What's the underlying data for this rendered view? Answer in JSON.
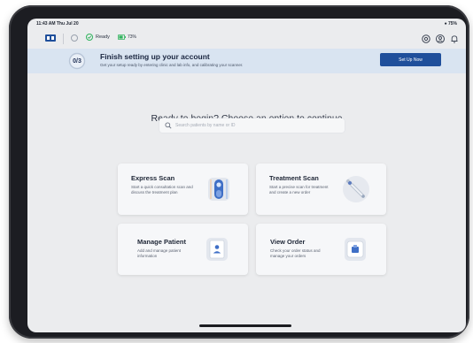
{
  "status_bar": {
    "time": "11:43 AM Thu Jul 20",
    "battery": "75%"
  },
  "topbar": {
    "ready_label": "Ready",
    "battery_label": "73%"
  },
  "banner": {
    "progress": "0/3",
    "progress_fraction": 0,
    "title": "Finish setting up your account",
    "subtitle": "Get your setup ready by entering clinic and lab info, and calibrating your scanner.",
    "button": "Set Up Now"
  },
  "main": {
    "headline": "Ready to begin? Choose an option to continue",
    "search_placeholder": "Search patients by name or ID"
  },
  "cards": [
    {
      "title": "Express Scan",
      "description": "Start a quick consultation scan and discuss the treatment plan",
      "icon": "scanner-icon"
    },
    {
      "title": "Treatment Scan",
      "description": "Start a precise scan for treatment and create a new order",
      "icon": "wand-icon"
    },
    {
      "title": "Manage Patient",
      "description": "Add and manage patient information",
      "icon": "patient-card-icon"
    },
    {
      "title": "View Order",
      "description": "Check your order status and manage your orders",
      "icon": "order-box-icon"
    }
  ],
  "colors": {
    "accent": "#1f4f9b",
    "banner_bg": "#d9e4f1",
    "ready_green": "#2fb35c",
    "screen_bg": "#ebecee"
  }
}
